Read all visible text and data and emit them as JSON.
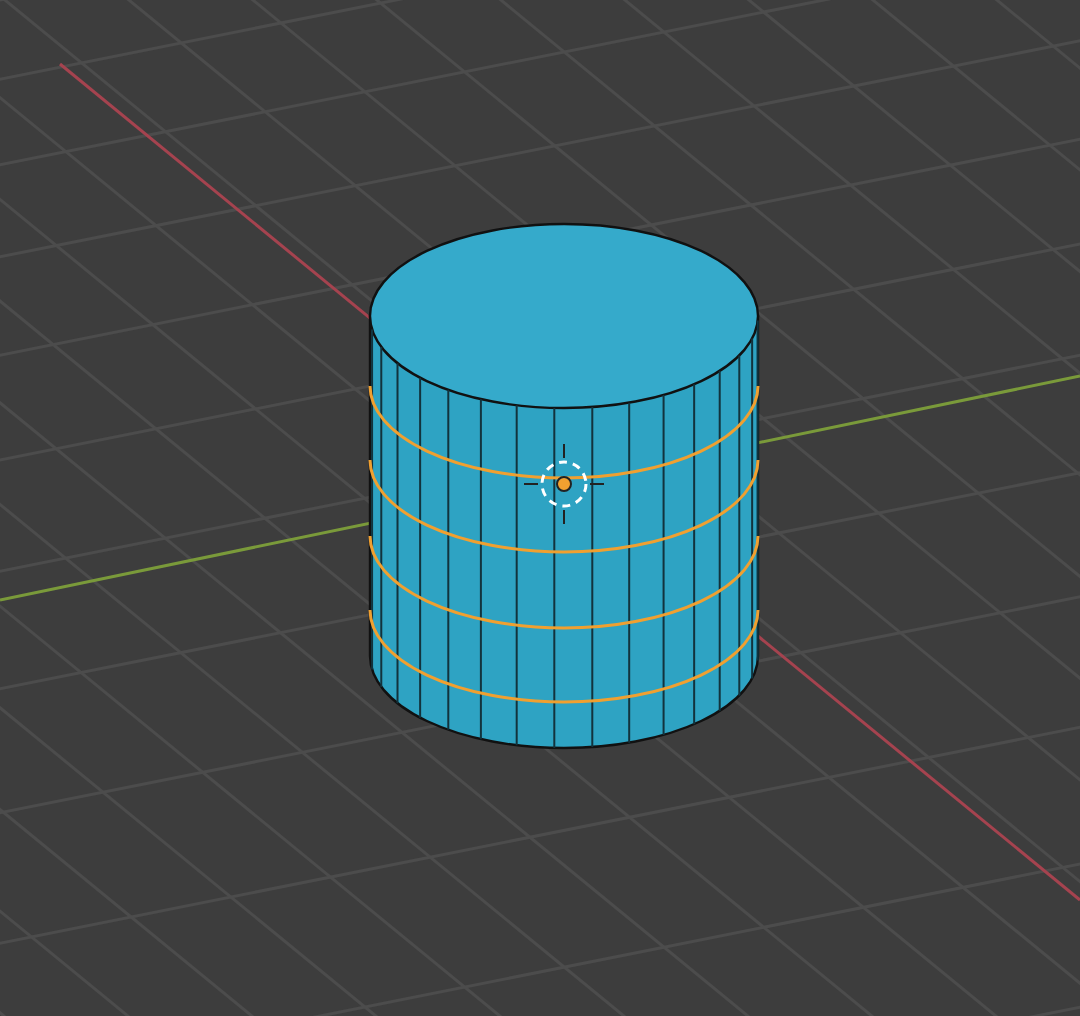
{
  "viewport": {
    "object": {
      "kind": "cylinder",
      "selected": true
    },
    "loops": [
      {
        "selected": true
      },
      {
        "selected": true
      },
      {
        "selected": true
      },
      {
        "selected": true
      }
    ]
  }
}
